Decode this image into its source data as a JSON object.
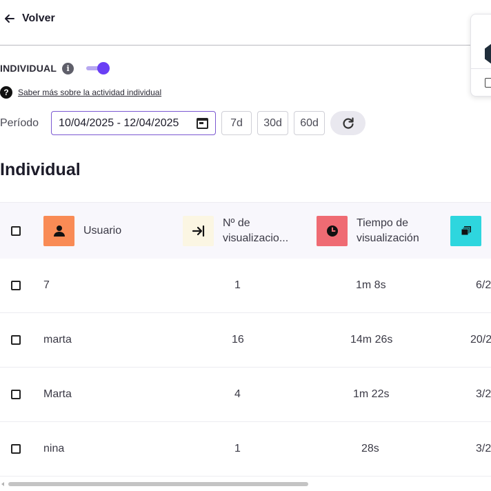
{
  "nav": {
    "back_label": "Volver"
  },
  "individual": {
    "label": "INDIVIDUAL",
    "info_icon": "info-icon",
    "toggle_on": true
  },
  "help": {
    "link_text": "Saber más sobre la actividad individual"
  },
  "period": {
    "label": "Período",
    "date_range": "10/04/2025 - 12/04/2025",
    "chips": [
      "7d",
      "30d",
      "60d"
    ]
  },
  "section_title": "Individual",
  "table": {
    "headers": [
      {
        "line1": "Usuario",
        "line2": "",
        "icon": "user-icon",
        "icon_bg": "#f98b55"
      },
      {
        "line1": "Nº de",
        "line2": "visualizacio...",
        "icon": "login-icon",
        "icon_bg": "#fbf6e3"
      },
      {
        "line1": "Tiempo de",
        "line2": "visualización",
        "icon": "clock-icon",
        "icon_bg": "#ef6b73"
      },
      {
        "line1": "",
        "line2": "",
        "icon": "layers-icon",
        "icon_bg": "#2ed6de"
      }
    ],
    "rows": [
      {
        "user": "7",
        "views": "1",
        "time": "1m 8s",
        "ratio": "6/2"
      },
      {
        "user": "marta",
        "views": "16",
        "time": "14m 26s",
        "ratio": "20/2"
      },
      {
        "user": "Marta",
        "views": "4",
        "time": "1m 22s",
        "ratio": "3/2"
      },
      {
        "user": "nina",
        "views": "1",
        "time": "28s",
        "ratio": "3/2"
      }
    ]
  },
  "colors": {
    "accent": "#6a3ff5",
    "border_accent": "#7a57d1"
  }
}
